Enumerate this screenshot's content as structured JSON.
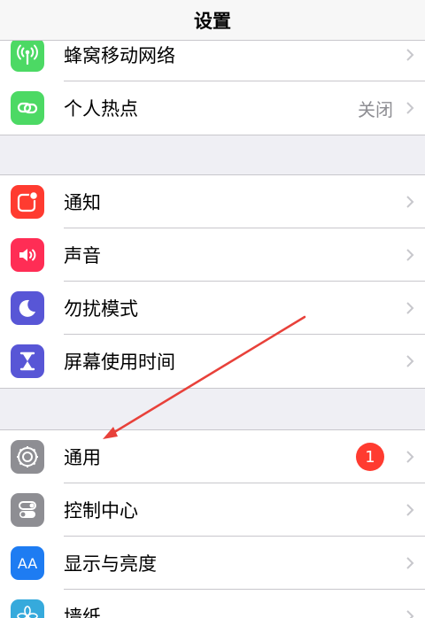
{
  "header": {
    "title": "设置"
  },
  "groups": [
    {
      "items": [
        {
          "label": "蜂窝移动网络",
          "icon": "antenna-icon",
          "color": "#4cd964"
        },
        {
          "label": "个人热点",
          "value": "关闭",
          "icon": "hotspot-link-icon",
          "color": "#4cd964"
        }
      ]
    },
    {
      "items": [
        {
          "label": "通知",
          "icon": "notifications-icon",
          "color": "#ff3b30"
        },
        {
          "label": "声音",
          "icon": "speaker-icon",
          "color": "#ff2d55"
        },
        {
          "label": "勿扰模式",
          "icon": "moon-icon",
          "color": "#5856d6"
        },
        {
          "label": "屏幕使用时间",
          "icon": "hourglass-icon",
          "color": "#5856d6"
        }
      ]
    },
    {
      "items": [
        {
          "label": "通用",
          "badge": "1",
          "icon": "gear-icon",
          "color": "#8e8e93"
        },
        {
          "label": "控制中心",
          "icon": "toggles-icon",
          "color": "#8e8e93"
        },
        {
          "label": "显示与亮度",
          "icon": "text-size-icon",
          "icon_text": "AA",
          "color": "#1e7cf2"
        },
        {
          "label": "墙纸",
          "icon": "flower-icon",
          "color": "#36aadc"
        }
      ]
    }
  ],
  "annotation": {
    "color": "#e8413a",
    "icon": "red-arrow-annotation"
  }
}
